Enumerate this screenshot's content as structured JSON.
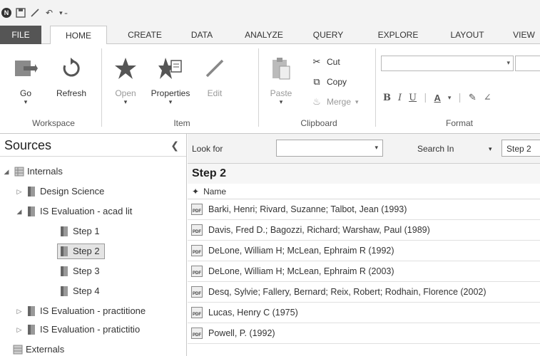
{
  "quick_access": {
    "icons": [
      "app-logo-icon",
      "save-icon",
      "edit-icon",
      "undo-icon",
      "customize-icon"
    ]
  },
  "ribbon_tabs": [
    "FILE",
    "HOME",
    "CREATE",
    "DATA",
    "ANALYZE",
    "QUERY",
    "EXPLORE",
    "LAYOUT",
    "VIEW"
  ],
  "active_tab": "HOME",
  "ribbon": {
    "workspace": {
      "go": "Go",
      "refresh": "Refresh",
      "label": "Workspace"
    },
    "item": {
      "open": "Open",
      "properties": "Properties",
      "edit": "Edit",
      "label": "Item"
    },
    "clipboard": {
      "paste": "Paste",
      "cut": "Cut",
      "copy": "Copy",
      "merge": "Merge",
      "label": "Clipboard"
    },
    "format": {
      "bold": "B",
      "italic": "I",
      "underline": "U",
      "label": "Format"
    }
  },
  "nav": {
    "title": "Sources",
    "tree": [
      {
        "label": "Internals",
        "arrow": "◢",
        "level": 0
      },
      {
        "label": "Design Science",
        "arrow": "▷",
        "level": 1
      },
      {
        "label": "IS Evaluation - acad lit",
        "arrow": "◢",
        "level": 1
      },
      {
        "label": "Step 1",
        "arrow": "",
        "level": 2
      },
      {
        "label": "Step 2",
        "arrow": "",
        "level": 2,
        "selected": true
      },
      {
        "label": "Step 3",
        "arrow": "",
        "level": 2
      },
      {
        "label": "Step 4",
        "arrow": "",
        "level": 2
      },
      {
        "label": "IS Evaluation - practitione",
        "arrow": "▷",
        "level": 1
      },
      {
        "label": "IS Evaluation - pratictitio",
        "arrow": "▷",
        "level": 1
      },
      {
        "label": "Externals",
        "arrow": "",
        "level": 0
      }
    ]
  },
  "findbar": {
    "look_for": "Look for",
    "look_for_value": "",
    "search_in": "Search In",
    "search_in_value": "Step 2"
  },
  "list": {
    "title": "Step 2",
    "column": "Name",
    "file_icon_text": "PDF",
    "rows": [
      "Barki, Henri; Rivard, Suzanne; Talbot, Jean (1993)",
      "Davis, Fred D.; Bagozzi, Richard; Warshaw, Paul (1989)",
      "DeLone, William H; McLean, Ephraim R (1992)",
      "DeLone, William H; McLean, Ephraim R (2003)",
      "Desq, Sylvie; Fallery, Bernard; Reix, Robert; Rodhain, Florence (2002)",
      "Lucas, Henry C (1975)",
      "Powell, P. (1992)"
    ]
  }
}
